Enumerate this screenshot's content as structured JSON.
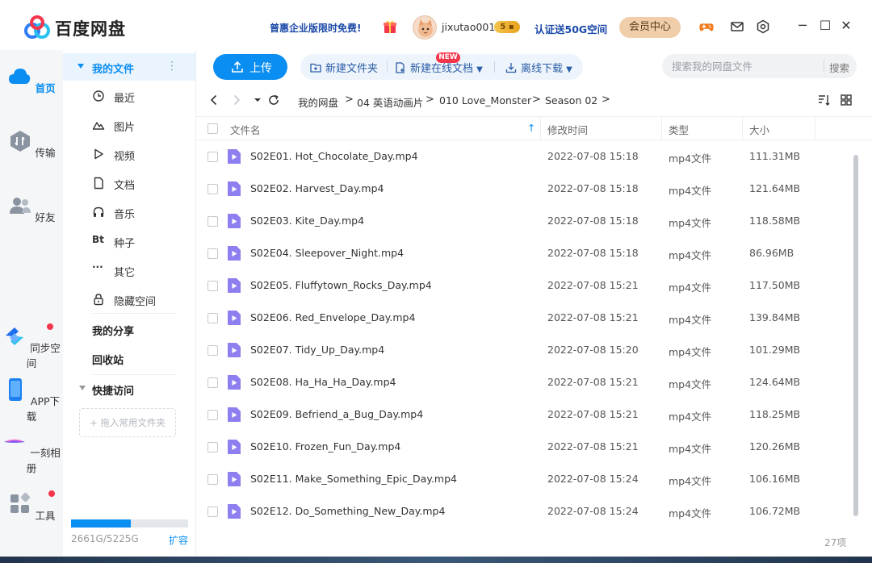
{
  "app": {
    "title": "百度网盘",
    "promo": "普惠企业版限时免费!",
    "username": "jixutao001",
    "vip_level": "5",
    "certify": "认证送50G空间",
    "member_center": "会员中心"
  },
  "rail": [
    {
      "label": "首页",
      "icon": "cloud-home-icon"
    },
    {
      "label": "传输",
      "icon": "transfer-icon"
    },
    {
      "label": "好友",
      "icon": "friends-icon"
    },
    {
      "label": "同步空间",
      "icon": "sync-space-icon"
    },
    {
      "label": "APP下载",
      "icon": "phone-icon"
    },
    {
      "label": "一刻相册",
      "icon": "album-icon"
    },
    {
      "label": "工具",
      "icon": "tools-icon"
    }
  ],
  "nav": {
    "my_files": "我的文件",
    "items": [
      {
        "label": "最近",
        "icon": "clock-icon"
      },
      {
        "label": "图片",
        "icon": "image-icon"
      },
      {
        "label": "视频",
        "icon": "video-icon"
      },
      {
        "label": "文档",
        "icon": "document-icon"
      },
      {
        "label": "音乐",
        "icon": "headphones-icon"
      },
      {
        "label": "种子",
        "icon": "bt-icon"
      },
      {
        "label": "其它",
        "icon": "more-icon"
      },
      {
        "label": "隐藏空间",
        "icon": "lock-icon"
      }
    ],
    "my_share": "我的分享",
    "recycle": "回收站",
    "quick_access": "快捷访问",
    "drag_hint": "+ 拖入常用文件夹",
    "quota": "2661G/5225G",
    "quota_used_fraction": 0.51,
    "expand": "扩容",
    "bt_glyph": "Bt"
  },
  "toolbar": {
    "upload": "上传",
    "new_folder": "新建文件夹",
    "new_online_doc": "新建在线文档",
    "new_badge": "NEW",
    "offline_download": "离线下载",
    "search_placeholder": "搜索我的网盘文件",
    "search_button": "搜索"
  },
  "breadcrumb": [
    "我的网盘",
    "04 英语动画片",
    "010 Love_Monster",
    "Season 02"
  ],
  "table": {
    "headers": {
      "name": "文件名",
      "modified": "修改时间",
      "type": "类型",
      "size": "大小"
    },
    "rows": [
      {
        "name": "S02E01. Hot_Chocolate_Day.mp4",
        "modified": "2022-07-08 15:18",
        "type": "mp4文件",
        "size": "111.31MB"
      },
      {
        "name": "S02E02. Harvest_Day.mp4",
        "modified": "2022-07-08 15:18",
        "type": "mp4文件",
        "size": "121.64MB"
      },
      {
        "name": "S02E03. Kite_Day.mp4",
        "modified": "2022-07-08 15:18",
        "type": "mp4文件",
        "size": "118.58MB"
      },
      {
        "name": "S02E04. Sleepover_Night.mp4",
        "modified": "2022-07-08 15:18",
        "type": "mp4文件",
        "size": "86.96MB"
      },
      {
        "name": "S02E05. Fluffytown_Rocks_Day.mp4",
        "modified": "2022-07-08 15:21",
        "type": "mp4文件",
        "size": "117.50MB"
      },
      {
        "name": "S02E06. Red_Envelope_Day.mp4",
        "modified": "2022-07-08 15:21",
        "type": "mp4文件",
        "size": "139.84MB"
      },
      {
        "name": "S02E07. Tidy_Up_Day.mp4",
        "modified": "2022-07-08 15:20",
        "type": "mp4文件",
        "size": "101.29MB"
      },
      {
        "name": "S02E08. Ha_Ha_Ha_Day.mp4",
        "modified": "2022-07-08 15:21",
        "type": "mp4文件",
        "size": "124.64MB"
      },
      {
        "name": "S02E09. Befriend_a_Bug_Day.mp4",
        "modified": "2022-07-08 15:21",
        "type": "mp4文件",
        "size": "118.25MB"
      },
      {
        "name": "S02E10. Frozen_Fun_Day.mp4",
        "modified": "2022-07-08 15:21",
        "type": "mp4文件",
        "size": "120.26MB"
      },
      {
        "name": "S02E11. Make_Something_Epic_Day.mp4",
        "modified": "2022-07-08 15:24",
        "type": "mp4文件",
        "size": "106.16MB"
      },
      {
        "name": "S02E12. Do_Something_New_Day.mp4",
        "modified": "2022-07-08 15:24",
        "type": "mp4文件",
        "size": "106.72MB"
      }
    ],
    "count": "27项"
  },
  "colors": {
    "accent": "#0a8ef2",
    "promo": "#1c4aa8",
    "video_icon": "#8d7ff0",
    "badge": "#f4364c"
  }
}
